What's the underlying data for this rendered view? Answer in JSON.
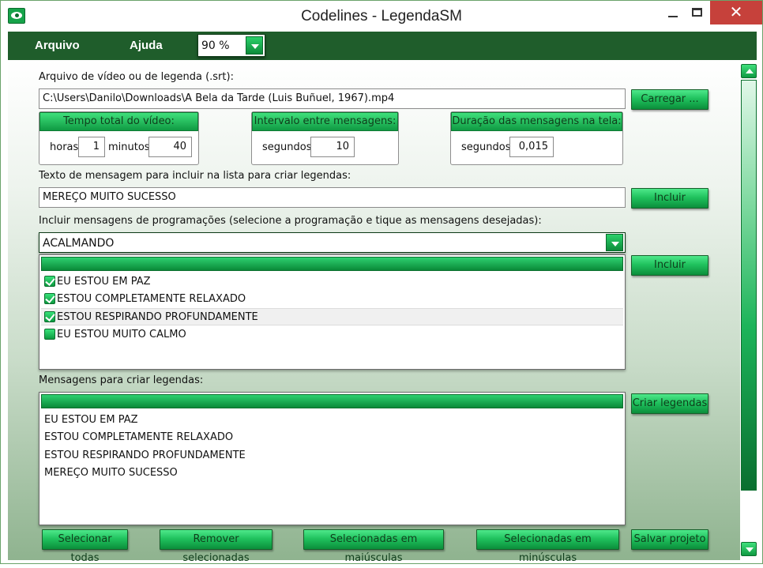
{
  "window": {
    "title": "Codelines - LegendaSM"
  },
  "menu": {
    "file": "Arquivo",
    "help": "Ajuda",
    "zoom": "90 %"
  },
  "file_section": {
    "label": "Arquivo de vídeo ou de legenda (.srt):",
    "path": "C:\\Users\\Danilo\\Downloads\\A Bela da Tarde (Luis Buñuel, 1967).mp4",
    "load_button": "Carregar ..."
  },
  "video_time": {
    "title": "Tempo total do vídeo:",
    "hours_label": "horas:",
    "hours": "1",
    "minutes_label": "minutos:",
    "minutes": "40"
  },
  "interval": {
    "title": "Intervalo entre mensagens:",
    "seconds_label": "segundos:",
    "seconds": "10"
  },
  "duration": {
    "title": "Duração das mensagens na tela:",
    "seconds_label": "segundos:",
    "seconds": "0,015"
  },
  "message_text": {
    "label": "Texto de mensagem para incluir na lista para criar legendas:",
    "value": "MEREÇO MUITO SUCESSO",
    "include_button": "Incluir"
  },
  "programming": {
    "label": "Incluir mensagens de programações (selecione a programação e tique as mensagens desejadas):",
    "selected": "ACALMANDO",
    "include_button": "Incluir",
    "items": [
      {
        "text": "EU ESTOU EM PAZ",
        "checked": true
      },
      {
        "text": "ESTOU COMPLETAMENTE RELAXADO",
        "checked": true
      },
      {
        "text": "ESTOU RESPIRANDO PROFUNDAMENTE",
        "checked": true
      },
      {
        "text": "EU ESTOU MUITO CALMO",
        "checked": false
      }
    ]
  },
  "messages": {
    "label": "Mensagens para criar legendas:",
    "create_button": "Criar legendas",
    "items": [
      "EU ESTOU EM PAZ",
      "ESTOU COMPLETAMENTE RELAXADO",
      "ESTOU RESPIRANDO PROFUNDAMENTE",
      "MEREÇO MUITO SUCESSO"
    ]
  },
  "bottom_buttons": {
    "select_all": "Selecionar todas",
    "remove_selected": "Remover selecionadas",
    "uppercase": "Selecionadas em maiúsculas",
    "lowercase": "Selecionadas em minúsculas",
    "save_project": "Salvar projeto"
  }
}
